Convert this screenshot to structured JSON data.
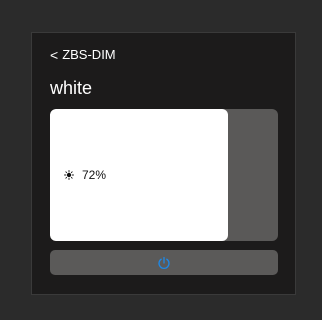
{
  "header": {
    "back_label": "ZBS-DIM",
    "title": "white"
  },
  "dimmer": {
    "level_text": "72%",
    "level_fraction": 0.78,
    "icon": "sun-icon"
  },
  "controls": {
    "power_icon": "power-icon",
    "power_color": "#1e88e5"
  },
  "colors": {
    "background": "#2b2b2b",
    "screen": "#1c1b1b",
    "track": "#5a5958",
    "fill": "#ffffff"
  }
}
